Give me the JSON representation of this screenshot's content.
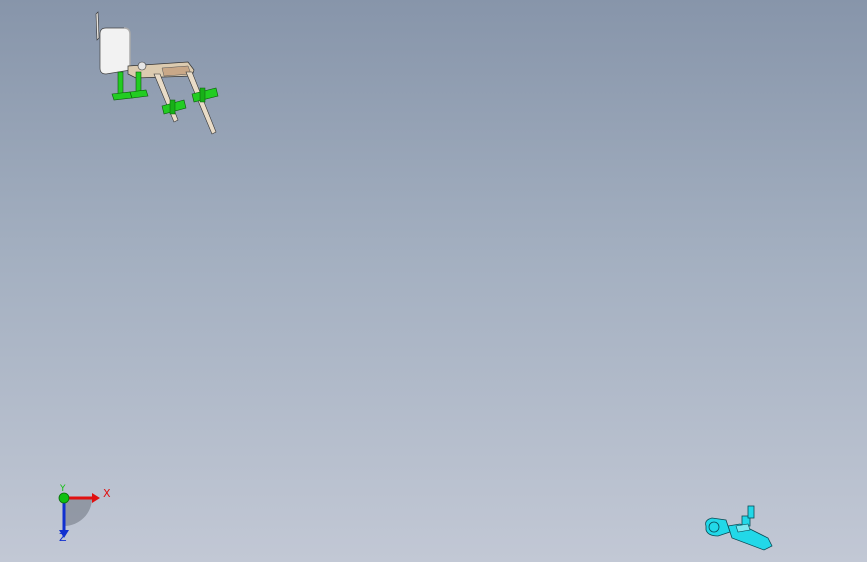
{
  "triad": {
    "x_label": "X",
    "y_label": "Y",
    "z_label": "Z",
    "colors": {
      "x": "#e01010",
      "y": "#10c010",
      "z": "#1030d0"
    }
  },
  "models": [
    {
      "name": "bracket-assembly",
      "colors": [
        "#f2f2f2",
        "#d8c8b0",
        "#22cc22"
      ]
    },
    {
      "name": "cyan-fitting",
      "colors": [
        "#22d8e8"
      ]
    }
  ],
  "viewport": {
    "background_top": "#8795aa",
    "background_bottom": "#c2c8d5"
  }
}
